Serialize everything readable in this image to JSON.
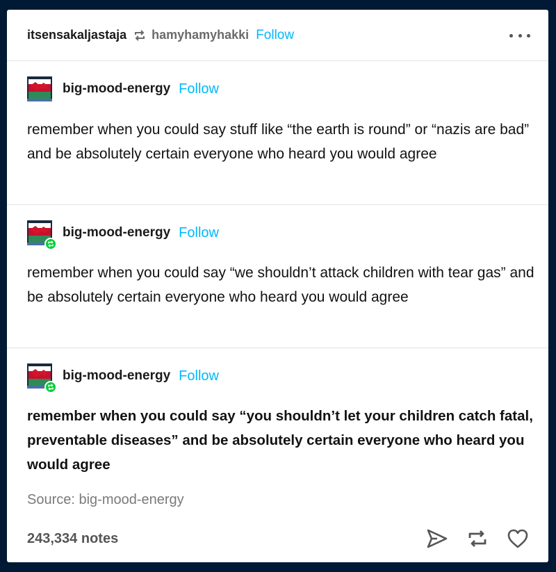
{
  "header": {
    "reblogger": "itsensakaljastaja",
    "source_user": "hamyhamyhakki",
    "follow_label": "Follow"
  },
  "trail": [
    {
      "user": "big-mood-energy",
      "follow_label": "Follow",
      "text": "remember when you could say stuff like “the earth is round” or “nazis are bad” and be absolutely certain everyone who heard you would agree"
    },
    {
      "user": "big-mood-energy",
      "follow_label": "Follow",
      "text": "remember when you could say “we shouldn’t attack children with tear gas” and be absolutely certain everyone who heard you would agree"
    },
    {
      "user": "big-mood-energy",
      "follow_label": "Follow",
      "text": "remember when you could say “you shouldn’t let your children catch fatal, preventable diseases” and be absolutely certain everyone who heard you would agree"
    }
  ],
  "source": "Source: big-mood-energy",
  "notes": "243,334 notes",
  "icons": {
    "reblog": "reblog-icon",
    "more": "more-icon",
    "share": "share-icon",
    "reblog_action": "reblog-icon",
    "like": "heart-icon",
    "avatar": "avatar-icon"
  },
  "colors": {
    "follow": "#00b8ff",
    "badge": "#00cf35",
    "background": "#001935"
  }
}
